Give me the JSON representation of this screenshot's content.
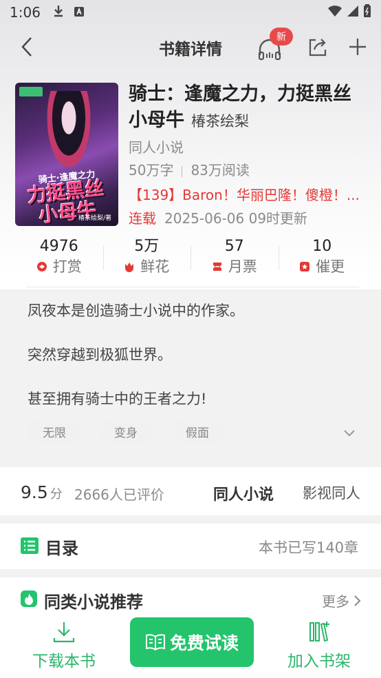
{
  "status_bar": {
    "time": "1:06"
  },
  "header": {
    "title": "书籍详情",
    "badge": "新"
  },
  "book": {
    "title": "骑士：逢魔之力，力挺黑丝小母牛",
    "author": "椿茶绘梨",
    "category": "同人小说",
    "words": "50万字",
    "reads": "83万阅读",
    "latest_chapter": "【139】Baron！华丽巴隆！傻橙！...",
    "status": "连载",
    "updated": "2025-06-06 09时更新",
    "cover": {
      "line1": "骑士·逢魔之力",
      "line2": "力挺黑丝小母牛",
      "line3": "椿茶绘梨/著"
    }
  },
  "actions": [
    {
      "num": "4976",
      "label": "打赏",
      "icon": "reward-icon",
      "color": "#e53935"
    },
    {
      "num": "5万",
      "label": "鲜花",
      "icon": "flower-icon",
      "color": "#e53935"
    },
    {
      "num": "57",
      "label": "月票",
      "icon": "ticket-icon",
      "color": "#e53935"
    },
    {
      "num": "10",
      "label": "催更",
      "icon": "urge-icon",
      "color": "#e53935"
    }
  ],
  "intro": [
    "凤夜本是创造骑士小说中的作家。",
    "突然穿越到极狐世界。",
    "甚至拥有骑士中的王者之力!"
  ],
  "tags": [
    "无限",
    "变身",
    "假面"
  ],
  "rating": {
    "score": "9.5",
    "unit": "分",
    "count": "2666人已评价",
    "categories": [
      "同人小说",
      "影视同人"
    ]
  },
  "toc": {
    "title": "目录",
    "count": "本书已写140章"
  },
  "recommend": {
    "title": "同类小说推荐",
    "more": "更多"
  },
  "bottom": {
    "download": "下载本书",
    "read": "免费试读",
    "shelf": "加入书架"
  },
  "colors": {
    "accent": "#23c46c",
    "red": "#e53935"
  }
}
